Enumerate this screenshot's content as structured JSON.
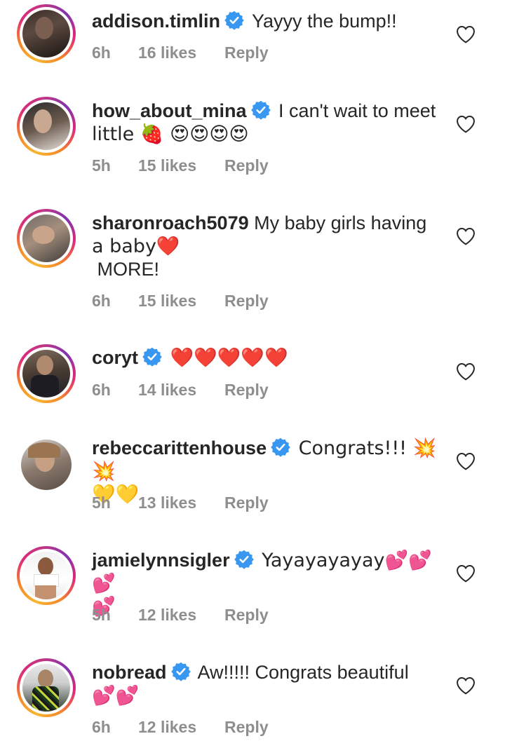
{
  "comments": [
    {
      "username": "addison.timlin",
      "verified": true,
      "text": "Yayyy the bump!!",
      "time": "6h",
      "likes": "16 likes",
      "reply": "Reply"
    },
    {
      "username": "how_about_mina",
      "verified": true,
      "text": "I can't wait to meet",
      "text2": "little 🍓 😍😍😍😍",
      "time": "5h",
      "likes": "15 likes",
      "reply": "Reply"
    },
    {
      "username": "sharonroach5079",
      "verified": false,
      "text": "My baby girls having",
      "text2": "a baby❤️",
      "text3": " MORE!",
      "time": "6h",
      "likes": "15 likes",
      "reply": "Reply"
    },
    {
      "username": "coryt",
      "verified": true,
      "text": "❤️❤️❤️❤️❤️",
      "time": "6h",
      "likes": "14 likes",
      "reply": "Reply"
    },
    {
      "username": "rebeccarittenhouse",
      "verified": true,
      "text": "Congrats!!! 💥💥",
      "text2": "💛💛",
      "time": "5h",
      "likes": "13 likes",
      "reply": "Reply"
    },
    {
      "username": "jamielynnsigler",
      "verified": true,
      "text": "Yayayayayay💕💕💕",
      "text2": "💕",
      "time": "5h",
      "likes": "12 likes",
      "reply": "Reply"
    },
    {
      "username": "nobread",
      "verified": true,
      "text": "Aw!!!!! Congrats beautiful",
      "text2": "💕💕",
      "time": "6h",
      "likes": "12 likes",
      "reply": "Reply"
    }
  ],
  "colors": {
    "verified_blue": "#3897f0",
    "meta_gray": "#8e8e8e",
    "story_ring": "#dd2a7b"
  },
  "icons": {
    "verified": "verified-badge-icon",
    "like": "heart-outline-icon"
  }
}
